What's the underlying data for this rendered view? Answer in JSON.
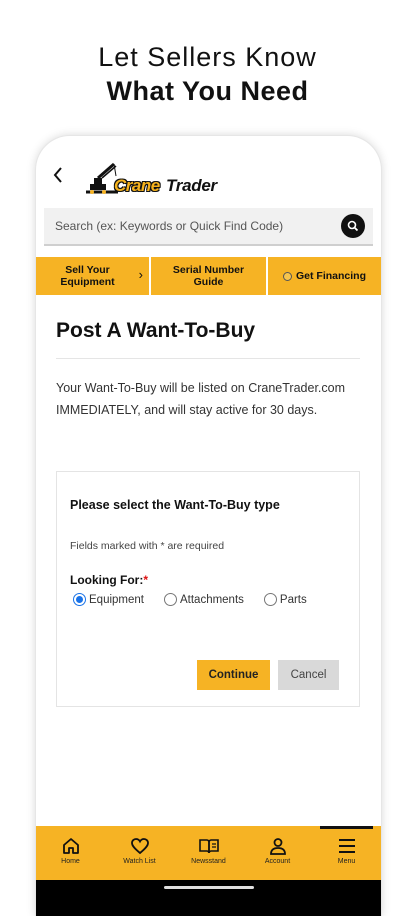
{
  "headline": {
    "line1": "Let Sellers Know",
    "line2": "What You Need"
  },
  "header": {
    "back_icon": "chevron-left-icon",
    "logo": {
      "word1": "Crane",
      "word2": "Trader",
      "mark": "·"
    }
  },
  "search": {
    "placeholder": "Search (ex: Keywords or Quick Find Code)",
    "icon": "search-icon"
  },
  "quicknav": {
    "sell_line1": "Sell Your",
    "sell_line2": "Equipment",
    "serial_line1": "Serial Number",
    "serial_line2": "Guide",
    "financing": "Get Financing"
  },
  "page": {
    "title": "Post A Want-To-Buy",
    "description": "Your Want-To-Buy will be listed on CraneTrader.com IMMEDIATELY, and will stay active for 30 days."
  },
  "form": {
    "heading": "Please select the Want-To-Buy type",
    "required_note": "Fields marked with * are required",
    "looking_for_label": "Looking For:",
    "required_star": "*",
    "options": [
      {
        "label": "Equipment",
        "selected": true
      },
      {
        "label": "Attachments",
        "selected": false
      },
      {
        "label": "Parts",
        "selected": false
      }
    ],
    "continue_label": "Continue",
    "cancel_label": "Cancel"
  },
  "bottom_nav": [
    {
      "label": "Home",
      "icon": "home-icon"
    },
    {
      "label": "Watch List",
      "icon": "heart-icon"
    },
    {
      "label": "Newsstand",
      "icon": "book-icon"
    },
    {
      "label": "Account",
      "icon": "person-icon"
    },
    {
      "label": "Menu",
      "icon": "hamburger-icon",
      "active": true
    }
  ],
  "colors": {
    "accent": "#f6b324",
    "dark": "#111111",
    "radio": "#1a73e8"
  }
}
